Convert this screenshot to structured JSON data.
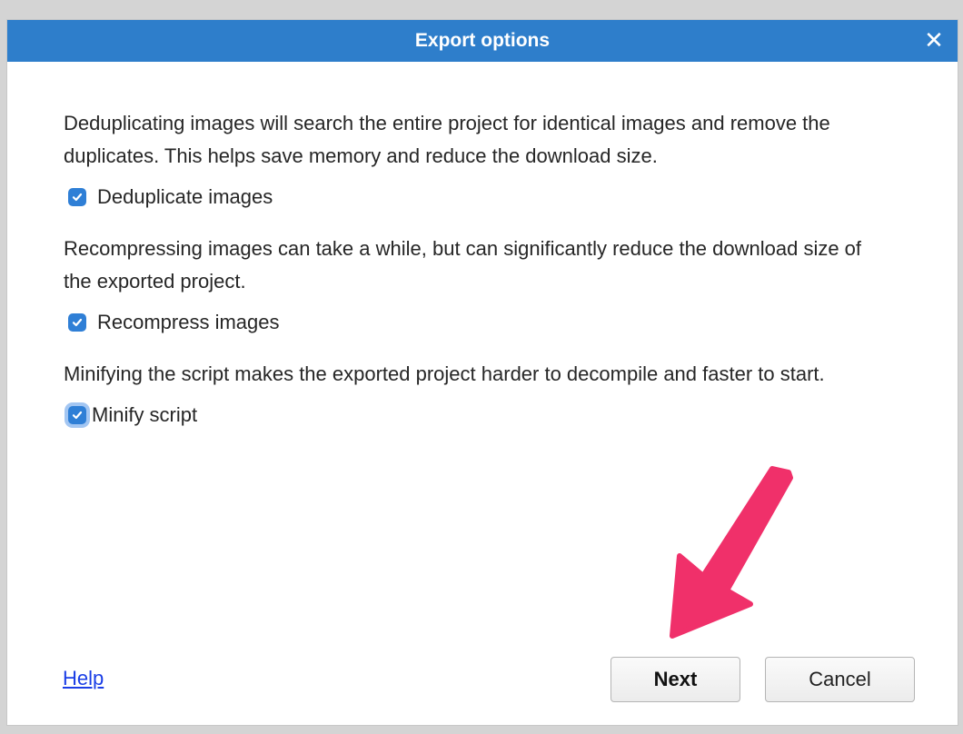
{
  "dialog": {
    "title": "Export options",
    "close_glyph": "✕"
  },
  "sections": [
    {
      "description": "Deduplicating images will search the entire project for identical images and remove the duplicates. This helps save memory and reduce the download size.",
      "checkbox_label": "Deduplicate images",
      "checked": true
    },
    {
      "description": "Recompressing images can take a while, but can significantly reduce the download size of the exported project.",
      "checkbox_label": "Recompress images",
      "checked": true
    },
    {
      "description": "Minifying the script makes the exported project harder to decompile and faster to start.",
      "checkbox_label": "Minify script",
      "checked": true
    }
  ],
  "footer": {
    "help_label": "Help",
    "next_label": "Next",
    "cancel_label": "Cancel"
  },
  "colors": {
    "titlebar": "#2e7ecb",
    "checkbox": "#2f7fd6",
    "link": "#1a3ee6",
    "annotation_arrow": "#f0306a"
  },
  "annotation": {
    "icon": "arrow-pointing-to-next-button"
  }
}
